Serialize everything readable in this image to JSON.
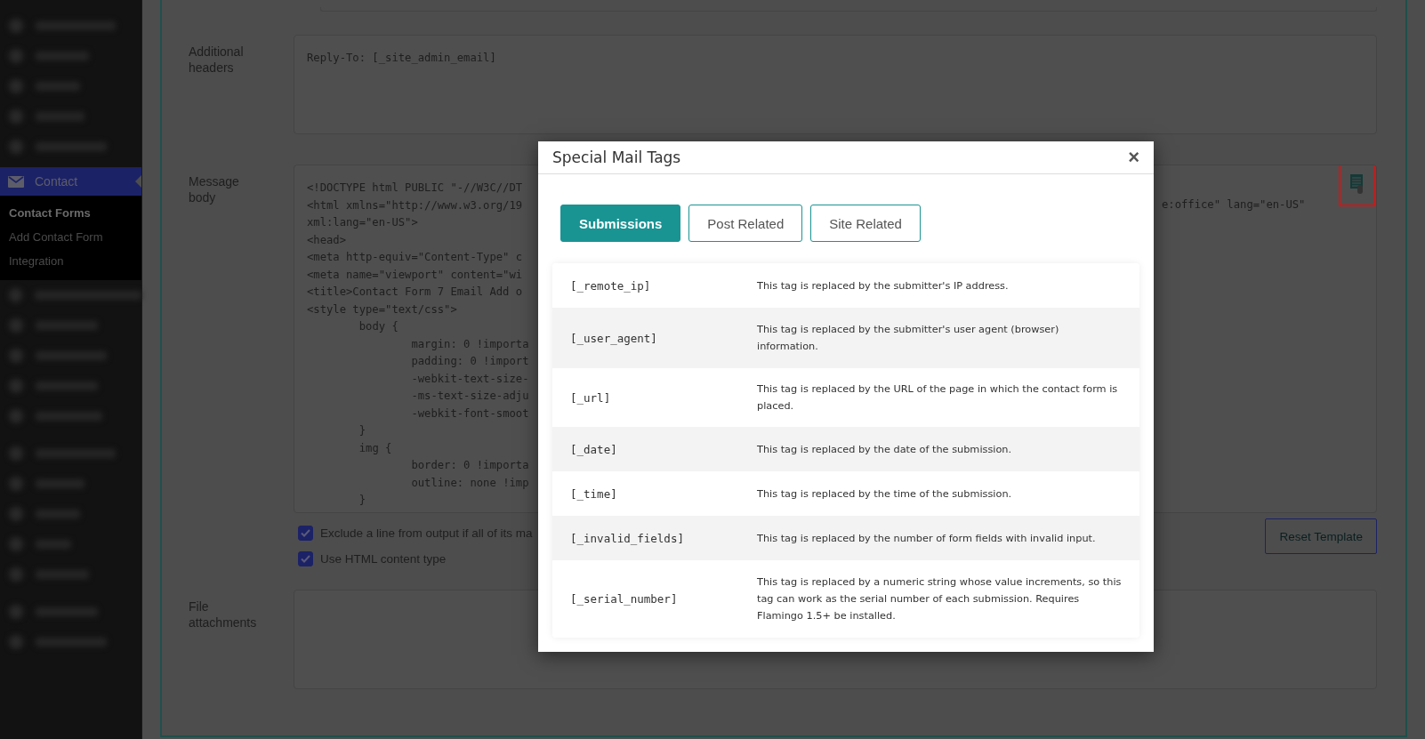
{
  "sidebar": {
    "active_item": {
      "label": "Contact",
      "selected": true
    },
    "submenu": [
      {
        "label": "Contact Forms",
        "selected": true
      },
      {
        "label": "Add Contact Form",
        "selected": false
      },
      {
        "label": "Integration",
        "selected": false
      }
    ]
  },
  "form": {
    "fields": [
      {
        "label": "Additional headers",
        "kind": "text",
        "lines": [
          "Reply-To: [_site_admin_email]"
        ]
      },
      {
        "label": "Message body",
        "kind": "code",
        "lines": [
          "<!DOCTYPE html PUBLIC \"-//W3C//DT",
          "<html xmlns=\"http://www.w3.org/19",
          "xml:lang=\"en-US\">",
          "<head>",
          "<meta http-equiv=\"Content-Type\" c",
          "<meta name=\"viewport\" content=\"wi",
          "<title>Contact Form 7 Email Add o",
          "<style type=\"text/css\">",
          "\tbody {",
          "\t\tmargin: 0 !importa",
          "\t\tpadding: 0 !import",
          "\t\t-webkit-text-size-",
          "\t\t-ms-text-size-adju",
          "\t\t-webkit-font-smoot",
          "\t}",
          "\timg {",
          "\t\tborder: 0 !importa",
          "\t\toutline: none !imp",
          "\t}"
        ],
        "right_fragment": "e:office\" lang=\"en-US\""
      },
      {
        "label": "File attachments",
        "kind": "text"
      }
    ],
    "options": [
      {
        "label": "Exclude a line from output if all of its ma",
        "checked": true
      },
      {
        "label": "Use HTML content type",
        "checked": true
      }
    ],
    "reset_button": "Reset Template"
  },
  "modal": {
    "title": "Special Mail Tags",
    "close": "×",
    "tabs": [
      {
        "label": "Submissions",
        "selected": true
      },
      {
        "label": "Post Related",
        "selected": false
      },
      {
        "label": "Site Related",
        "selected": false
      }
    ],
    "rows": [
      {
        "tag": "[_remote_ip]",
        "description": "This tag is replaced by the submitter's IP address."
      },
      {
        "tag": "[_user_agent]",
        "description": "This tag is replaced by the submitter's user agent (browser) information."
      },
      {
        "tag": "[_url]",
        "description": "This tag is replaced by the URL of the page in which the contact form is placed."
      },
      {
        "tag": "[_date]",
        "description": "This tag is replaced by the date of the submission."
      },
      {
        "tag": "[_time]",
        "description": "This tag is replaced by the time of the submission."
      },
      {
        "tag": "[_invalid_fields]",
        "description": "This tag is replaced by the number of form fields with invalid input."
      },
      {
        "tag": "[_serial_number]",
        "description": "This tag is replaced by a numeric string whose value increments, so this tag can work as the serial number of each submission. Requires Flamingo 1.5+ be installed."
      }
    ]
  }
}
